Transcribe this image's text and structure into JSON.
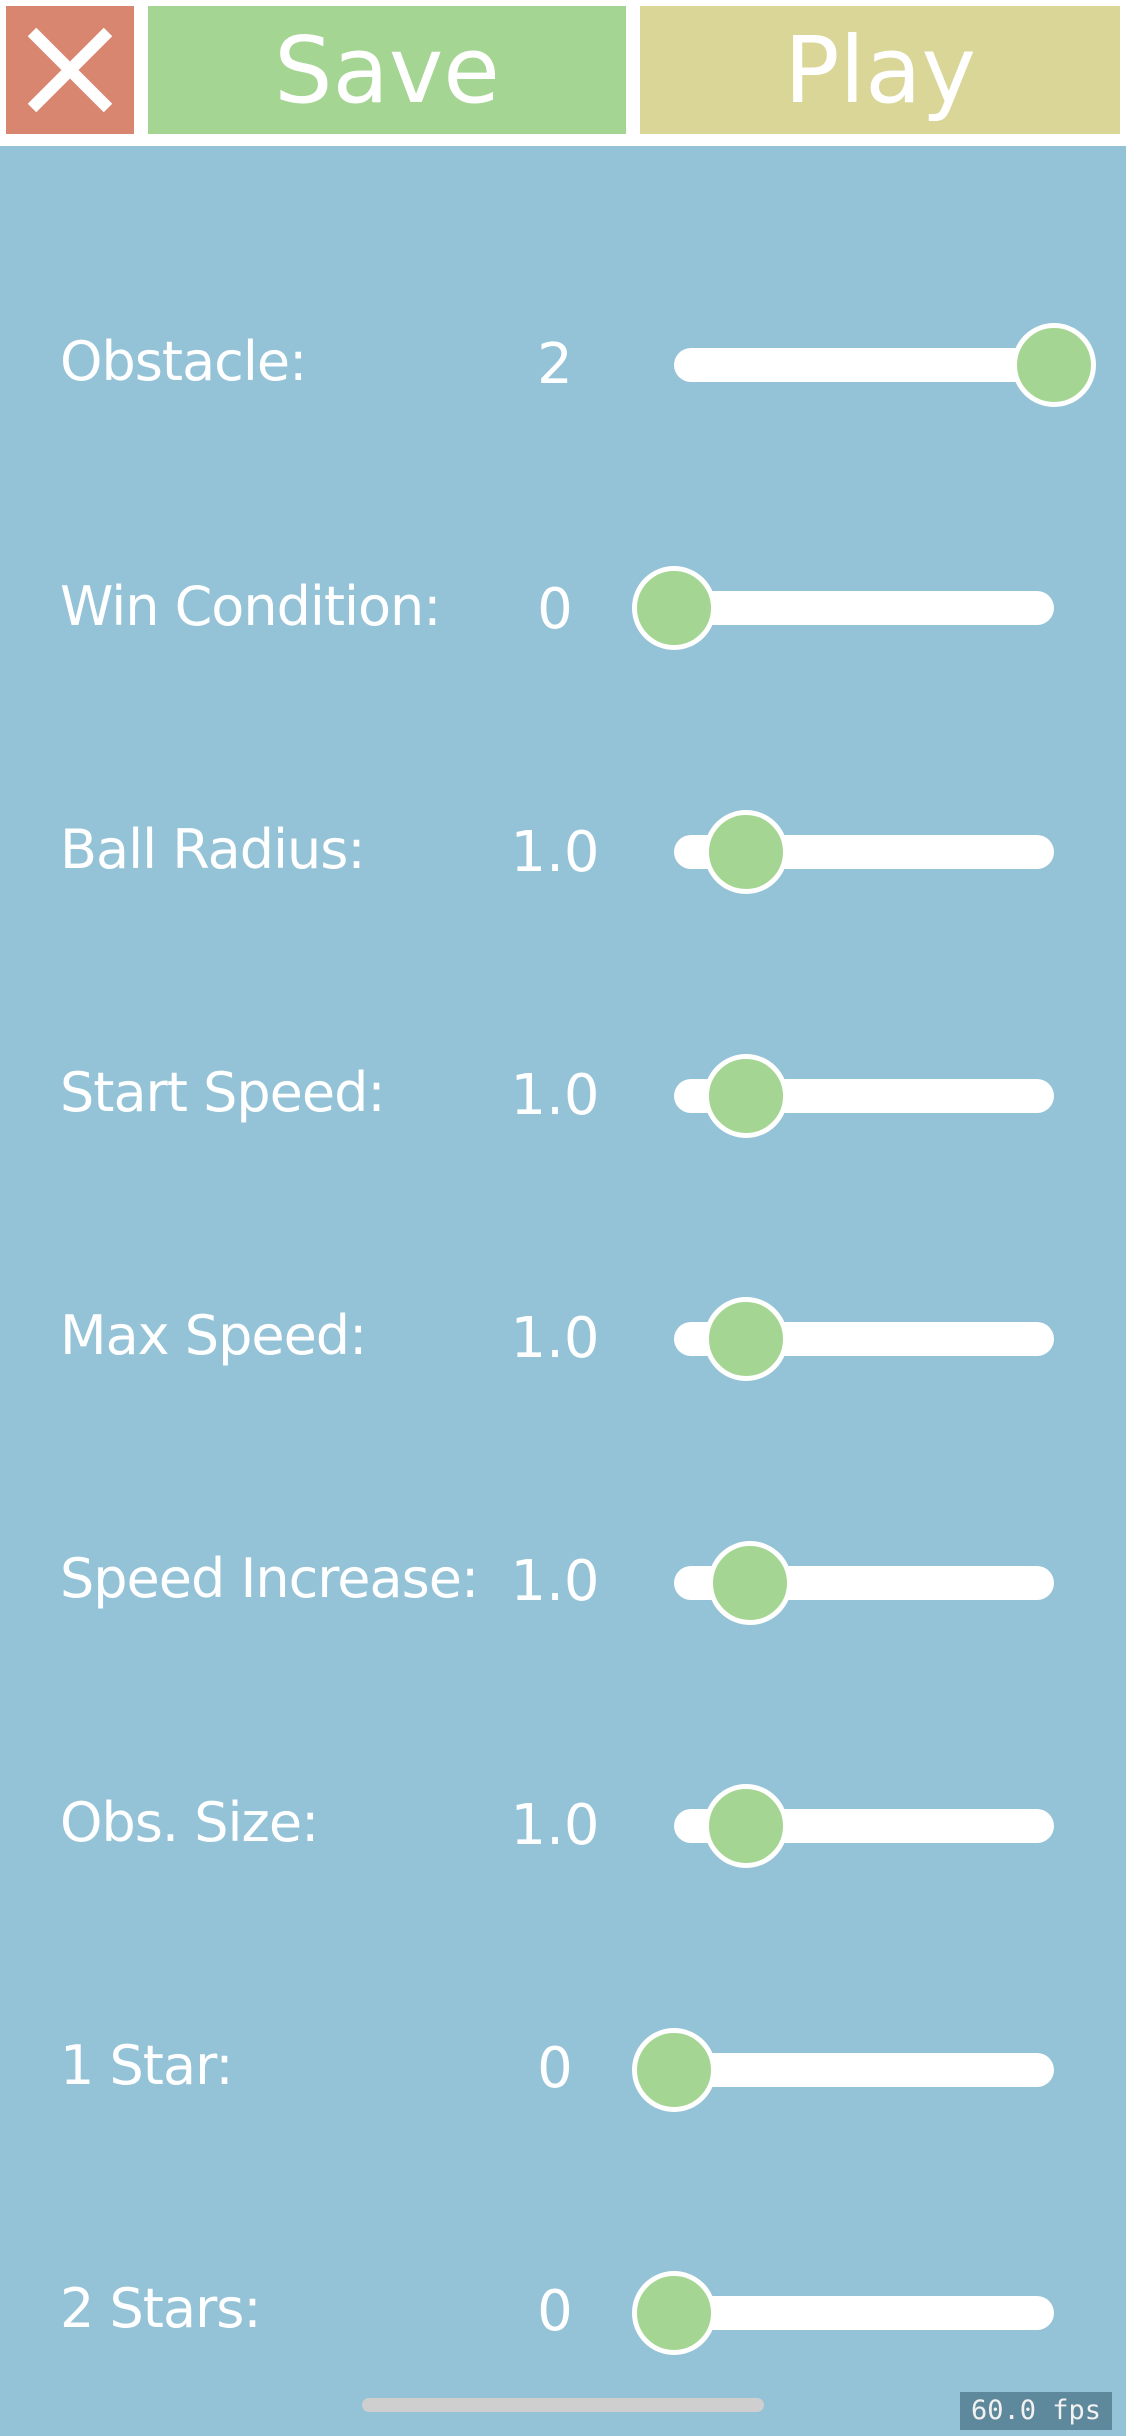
{
  "header": {
    "close_icon": "close-x-icon",
    "save_label": "Save",
    "play_label": "Play"
  },
  "settings": [
    {
      "label": "Obstacle:",
      "value": "2",
      "level": 1.0
    },
    {
      "label": "Win Condition:",
      "value": "0",
      "level": 0.0
    },
    {
      "label": "Ball Radius:",
      "value": "1.0",
      "level": 0.19
    },
    {
      "label": "Start Speed:",
      "value": "1.0",
      "level": 0.19
    },
    {
      "label": "Max Speed:",
      "value": "1.0",
      "level": 0.19
    },
    {
      "label": "Speed Increase:",
      "value": "1.0",
      "level": 0.2
    },
    {
      "label": "Obs. Size:",
      "value": "1.0",
      "level": 0.19
    },
    {
      "label": "1 Star:",
      "value": "0",
      "level": 0.0
    },
    {
      "label": "2 Stars:",
      "value": "0",
      "level": 0.0
    }
  ],
  "status": {
    "fps": "60.0 fps"
  },
  "colors": {
    "background": "#94c3d7",
    "close": "#d98670",
    "save": "#a5d593",
    "play": "#d9d697",
    "knob": "#a5d593"
  }
}
